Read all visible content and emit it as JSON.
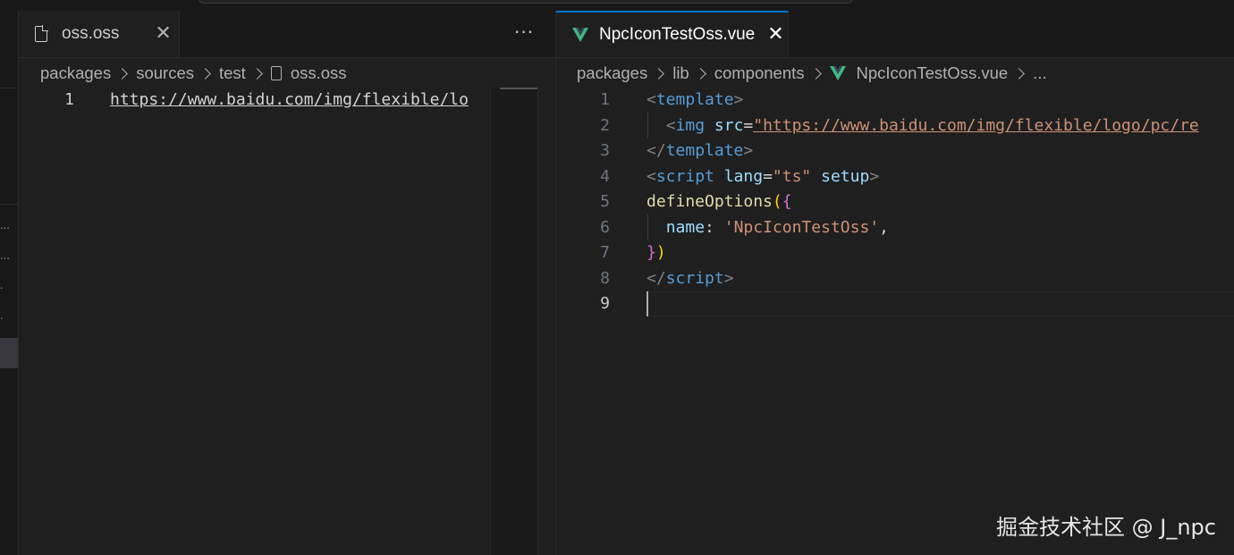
{
  "colors": {
    "background": "#1f1f1f",
    "tabbar": "#181818",
    "vue_icon": "#41b883",
    "tag": "#569cd6",
    "string": "#ce9178",
    "attribute": "#9cdcfe",
    "function": "#dcdcaa"
  },
  "sidebar": {
    "dots": [
      "…",
      "…",
      "·",
      "·"
    ]
  },
  "left_pane": {
    "tab": {
      "label": "oss.oss",
      "icon": "file-icon",
      "close": "✕"
    },
    "more_actions": "···",
    "breadcrumbs": [
      "packages",
      "sources",
      "test",
      "oss.oss"
    ],
    "line_numbers": [
      "1"
    ],
    "lines": [
      "https://www.baidu.com/img/flexible/lo"
    ]
  },
  "right_pane": {
    "tab": {
      "label": "NpcIconTestOss.vue",
      "icon": "vue-icon",
      "close": "✕"
    },
    "breadcrumbs": [
      "packages",
      "lib",
      "components",
      "NpcIconTestOss.vue",
      "..."
    ],
    "line_numbers": [
      "1",
      "2",
      "3",
      "4",
      "5",
      "6",
      "7",
      "8",
      "9"
    ],
    "code": {
      "l1": {
        "open": "<",
        "tag": "template",
        "close": ">"
      },
      "l2": {
        "open": "<",
        "tag": "img",
        "attr": "src",
        "eq": "=",
        "value": "\"https://www.baidu.com/img/flexible/logo/pc/re"
      },
      "l3": {
        "open": "</",
        "tag": "template",
        "close": ">"
      },
      "l4": {
        "open": "<",
        "tag": "script",
        "attr1": "lang",
        "eq": "=",
        "value": "\"ts\"",
        "attr2": "setup",
        "close": ">"
      },
      "l5": {
        "fn": "defineOptions",
        "paren": "(",
        "brace": "{"
      },
      "l6": {
        "prop": "name",
        "colon": ": ",
        "value": "'NpcIconTestOss'",
        "comma": ","
      },
      "l7": {
        "brace": "}",
        "paren": ")"
      },
      "l8": {
        "open": "</",
        "tag": "script",
        "close": ">"
      }
    }
  },
  "watermark": "掘金技术社区 @ J_npc"
}
